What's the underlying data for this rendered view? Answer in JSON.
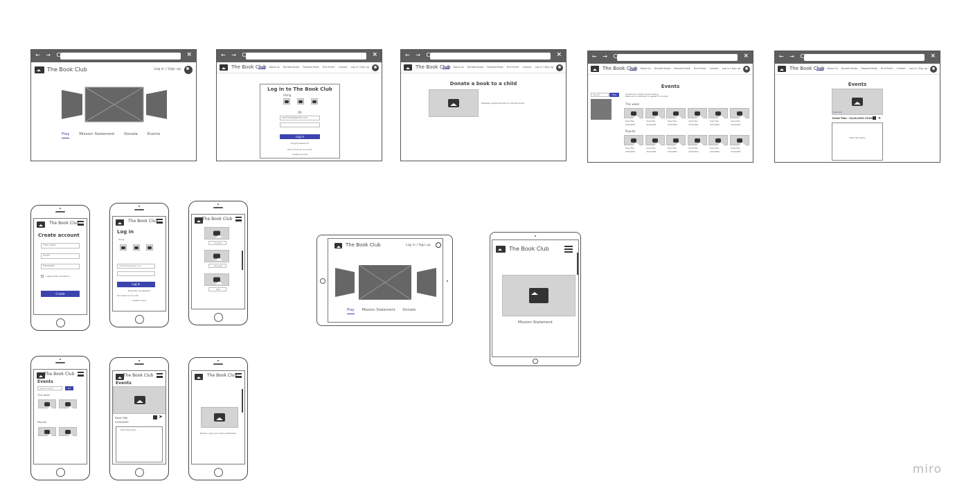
{
  "brand": "The Book Club",
  "auth": "Log in / Sign up",
  "nav_items": [
    "Home",
    "About Us",
    "Donate Books",
    "Request Book",
    "Find Event",
    "Contact",
    "Log In / Sign up"
  ],
  "nav_items_f1": [
    "Play",
    "Mission Statement",
    "Donate",
    "Events"
  ],
  "frame2": {
    "title": "Log in to The Book Club",
    "using": "Using",
    "providers": [
      "Facebook",
      "Google",
      "Twitter"
    ],
    "or": "OR",
    "email": "myEmail@gmail.com",
    "login": "Log In",
    "forgot": "Forgot password?",
    "noacc": "Don't have an account?",
    "create": "Create account"
  },
  "frame3": {
    "title": "Donate a book to a child",
    "text": "Message explaining how to donate books"
  },
  "frame4": {
    "title": "Events",
    "intro": "Guidelines to events: we are hosting\nMake sure to remember to register for an event",
    "this_week": "This week",
    "popular": "Popular",
    "search": "Search",
    "filter": "Filter",
    "card_title": "Event Title",
    "card_date": "01/01/2020"
  },
  "frame5": {
    "title": "Events",
    "event_line": "Event Title - 01/01/2020 15:00",
    "desc": "Event description",
    "tag": "Event Link"
  },
  "phone1": {
    "title": "Create account",
    "fields": [
      "First name",
      "Email",
      "Password"
    ],
    "terms": "I agree with conditions",
    "btn": "Create"
  },
  "phone2": {
    "title": "Log in",
    "using": "Using",
    "providers": [
      "Facebook",
      "Google",
      "Twitter"
    ],
    "email": "myEmail@gmail.com",
    "login": "Log In",
    "remember": "Remember me password",
    "noacc": "Don't have an account?",
    "create": "Create account"
  },
  "phone3": {
    "labels": [
      "Donate",
      "Request",
      "Play"
    ]
  },
  "phone4": {
    "title": "Events",
    "search": "Search event",
    "filter": "Go",
    "this_week": "This week",
    "popular": "Popular"
  },
  "phone5": {
    "title": "Events",
    "event": "Event Title",
    "date": "01/01/2020",
    "desc": "Event description"
  },
  "phone6": {
    "text": "Mission / logo and mission statement"
  },
  "tablet1": {
    "items": [
      "Play",
      "Mission Statement",
      "Donate"
    ]
  },
  "tablet2": {
    "caption": "Mission Statement"
  },
  "watermark": "miro"
}
